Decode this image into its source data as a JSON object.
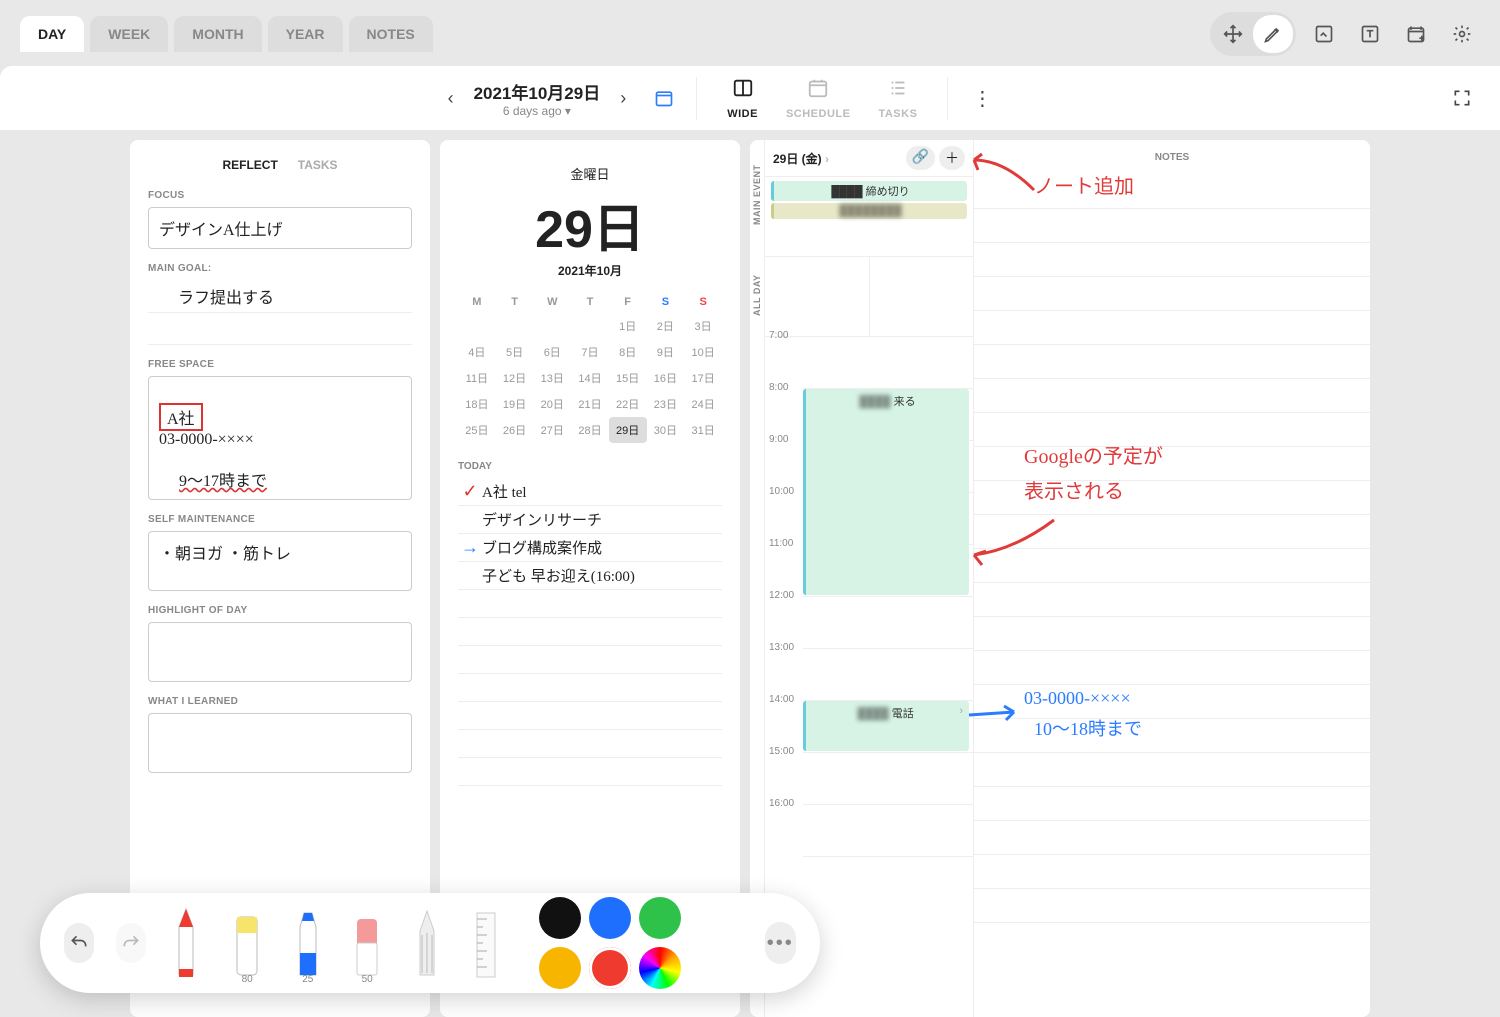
{
  "tabs": {
    "day": "DAY",
    "week": "WEEK",
    "month": "MONTH",
    "year": "YEAR",
    "notes": "NOTES"
  },
  "date": {
    "title": "2021年10月29日",
    "sub": "6 days ago"
  },
  "viewModes": {
    "wide": "WIDE",
    "schedule": "SCHEDULE",
    "tasks": "TASKS"
  },
  "leftTabs": {
    "reflect": "REFLECT",
    "tasks": "TASKS"
  },
  "labels": {
    "focus": "FOCUS",
    "mainGoal": "MAIN GOAL:",
    "freeSpace": "FREE SPACE",
    "selfMaint": "SELF MAINTENANCE",
    "highlight": "HIGHLIGHT OF DAY",
    "learned": "WHAT I LEARNED",
    "today": "TODAY",
    "notes": "NOTES",
    "mainEvent": "MAIN EVENT",
    "allDay": "ALL DAY"
  },
  "focusText": "デザインA仕上げ",
  "mainGoalText": "ラフ提出する",
  "freeTag": "A社",
  "freeLine1": "03-0000-××××",
  "freeLine2": "9〜17時まで",
  "selfMaintText": "・朝ヨガ ・筋トレ",
  "calendar": {
    "dow": "金曜日",
    "big": "29日",
    "ym": "2021年10月",
    "wk": [
      "M",
      "T",
      "W",
      "T",
      "F",
      "S",
      "S"
    ]
  },
  "todayItems": {
    "i1": "A社 tel",
    "i2": "デザインリサーチ",
    "i3": "ブログ構成案作成",
    "i4": "子ども 早お迎え(16:00)"
  },
  "tlDate": "29日 (金)",
  "events": {
    "deadline": "締め切り",
    "come": "来る",
    "call": "電話"
  },
  "annot": {
    "addNote": "ノート追加",
    "google1": "Googleの予定が",
    "google2": "表示される",
    "phone1": "03-0000-××××",
    "phone2": "10〜18時まで"
  },
  "hours": [
    "7:00",
    "8:00",
    "9:00",
    "10:00",
    "11:00",
    "12:00",
    "13:00",
    "14:00",
    "15:00",
    "16:00"
  ],
  "tools": {
    "s80": "80",
    "s25": "25",
    "s50": "50"
  },
  "swatches": {
    "black": "#111",
    "blue": "#1f6fff",
    "green": "#2fc24a",
    "yellow": "#f7b500",
    "red": "#ef3b2f",
    "rainbow": "conic"
  }
}
